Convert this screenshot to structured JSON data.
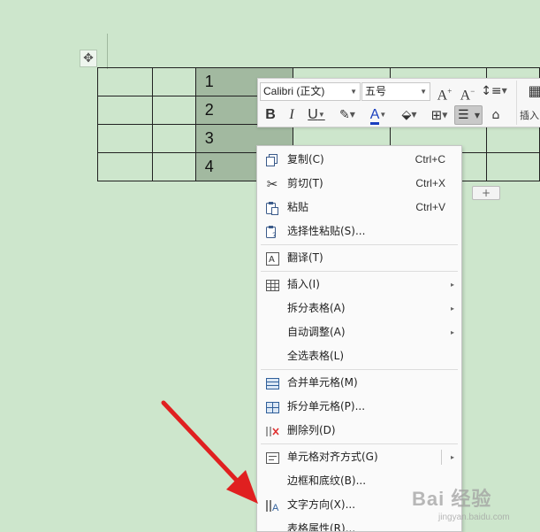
{
  "table": {
    "move_handle_icon": "move-cross-icon",
    "rows": [
      [
        "",
        "",
        "1",
        "",
        "",
        ""
      ],
      [
        "",
        "",
        "2",
        "",
        "",
        ""
      ],
      [
        "",
        "",
        "3",
        "",
        "",
        ""
      ],
      [
        "",
        "",
        "4",
        "",
        "",
        ""
      ]
    ],
    "add_row_label": "+",
    "selection_color": "#a2b9a0"
  },
  "mini_toolbar": {
    "font_name": "Calibri (正文)",
    "font_size": "五号",
    "grow_font": "A",
    "shrink_font": "A",
    "bold": "B",
    "italic": "I",
    "underline": "U",
    "insert_label": "插入"
  },
  "context_menu": {
    "items": [
      {
        "label": "复制(C)",
        "shortcut": "Ctrl+C",
        "icon": "copy-icon"
      },
      {
        "label": "剪切(T)",
        "shortcut": "Ctrl+X",
        "icon": "scissors-icon"
      },
      {
        "label": "粘贴",
        "shortcut": "Ctrl+V",
        "icon": "paste-icon"
      },
      {
        "label": "选择性粘贴(S)...",
        "shortcut": "",
        "icon": "paste-special-icon"
      },
      {
        "label": "翻译(T)",
        "shortcut": "",
        "icon": "translate-icon"
      },
      {
        "label": "插入(I)",
        "shortcut": "",
        "icon": "table-insert-icon",
        "submenu": true
      },
      {
        "label": "拆分表格(A)",
        "shortcut": "",
        "submenu": true
      },
      {
        "label": "自动调整(A)",
        "shortcut": "",
        "submenu": true
      },
      {
        "label": "全选表格(L)",
        "shortcut": ""
      },
      {
        "label": "合并单元格(M)",
        "shortcut": "",
        "icon": "merge-cells-icon"
      },
      {
        "label": "拆分单元格(P)...",
        "shortcut": "",
        "icon": "split-cells-icon"
      },
      {
        "label": "删除列(D)",
        "shortcut": "",
        "icon": "delete-column-icon"
      },
      {
        "label": "单元格对齐方式(G)",
        "shortcut": "",
        "icon": "cell-align-icon",
        "submenu": true
      },
      {
        "label": "边框和底纹(B)...",
        "shortcut": ""
      },
      {
        "label": "文字方向(X)...",
        "shortcut": "",
        "icon": "text-direction-icon"
      },
      {
        "label": "表格属性(R)...",
        "shortcut": ""
      }
    ]
  },
  "annotation": {
    "arrow_color": "#e02020"
  },
  "watermark": {
    "main": "Bai 经验",
    "sub": "jingyan.baidu.com"
  }
}
